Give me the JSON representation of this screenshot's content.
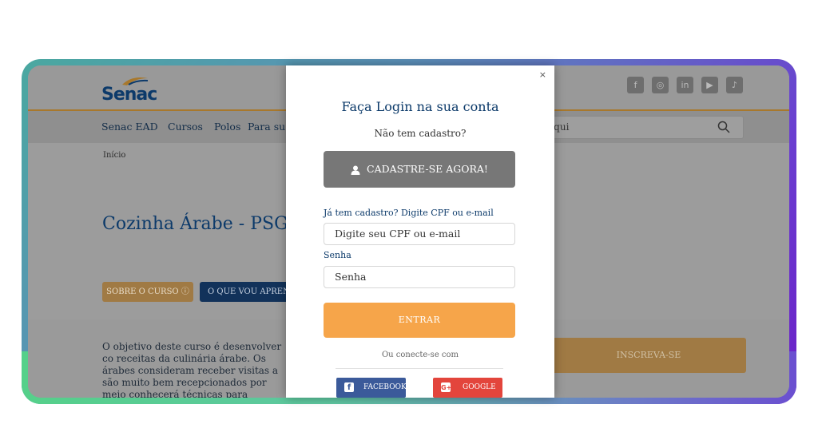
{
  "site": {
    "logo_text": "Senac",
    "nav": [
      "Senac EAD",
      "Cursos",
      "Polos",
      "Para su"
    ],
    "search_placeholder": "aqui",
    "breadcrumb": "Início",
    "course_title": "Cozinha Árabe - PSG",
    "btn_sobre": "SOBRE O CURSO",
    "btn_oque": "O QUE VOU APRENI",
    "description": "O objetivo deste curso é desenvolver co receitas da culinária árabe. Os árabes consideram receber visitas a são muito bem recepcionados por meio conhecerá técnicas para preparar vari",
    "btn_inscreva": "INSCREVA-SE",
    "social_icons": [
      "facebook-icon",
      "instagram-icon",
      "linkedin-icon",
      "youtube-icon",
      "tiktok-icon"
    ]
  },
  "modal": {
    "close": "×",
    "title": "Faça Login na sua conta",
    "subtitle": "Não tem cadastro?",
    "cadastre_label": "CADASTRE-SE AGORA!",
    "login_label": "Já tem cadastro? Digite CPF ou e-mail",
    "login_placeholder": "Digite seu CPF ou e-mail",
    "password_label": "Senha",
    "password_placeholder": "Senha",
    "entrar_label": "ENTRAR",
    "ou_label": "Ou conecte-se com",
    "facebook_label": "FACEBOOK",
    "google_label": "GOOGLE"
  },
  "colors": {
    "brand_blue": "#0c3a6a",
    "entrar_orange": "#f6a54a",
    "facebook_blue": "#3b5a9a",
    "google_red": "#e3453c"
  }
}
